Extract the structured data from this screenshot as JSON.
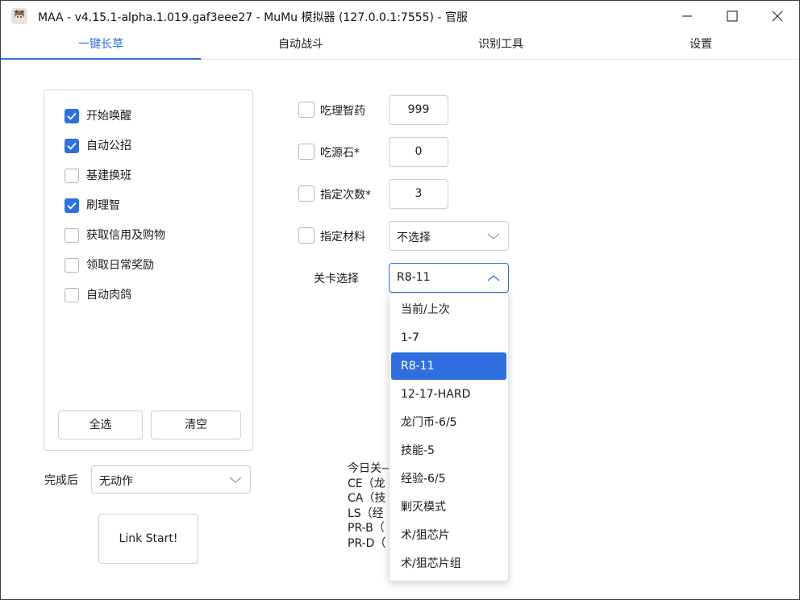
{
  "window": {
    "title": "MAA - v4.15.1-alpha.1.019.gaf3eee27 - MuMu 模拟器 (127.0.0.1:7555) - 官服"
  },
  "tabs": [
    {
      "label": "一键长草",
      "active": true
    },
    {
      "label": "自动战斗",
      "active": false
    },
    {
      "label": "识别工具",
      "active": false
    },
    {
      "label": "设置",
      "active": false
    }
  ],
  "tasks": [
    {
      "label": "开始唤醒",
      "checked": true
    },
    {
      "label": "自动公招",
      "checked": true
    },
    {
      "label": "基建换班",
      "checked": false
    },
    {
      "label": "刷理智",
      "checked": true
    },
    {
      "label": "获取信用及购物",
      "checked": false
    },
    {
      "label": "领取日常奖励",
      "checked": false
    },
    {
      "label": "自动肉鸽",
      "checked": false
    }
  ],
  "task_buttons": {
    "select_all": "全选",
    "clear": "清空"
  },
  "after_complete": {
    "label": "完成后",
    "value": "无动作"
  },
  "start_button": "Link Start!",
  "settings": {
    "medicine": {
      "label": "吃理智药",
      "value": "999",
      "checked": false
    },
    "stone": {
      "label": "吃源石*",
      "value": "0",
      "checked": false
    },
    "times": {
      "label": "指定次数*",
      "value": "3",
      "checked": false
    },
    "material": {
      "label": "指定材料",
      "value": "不选择",
      "checked": false
    },
    "stage": {
      "label": "关卡选择",
      "value": "R8-11"
    }
  },
  "stage_options": [
    {
      "label": "当前/上次",
      "selected": false
    },
    {
      "label": "1-7",
      "selected": false
    },
    {
      "label": "R8-11",
      "selected": true
    },
    {
      "label": "12-17-HARD",
      "selected": false
    },
    {
      "label": "龙门币-6/5",
      "selected": false
    },
    {
      "label": "技能-5",
      "selected": false
    },
    {
      "label": "经验-6/5",
      "selected": false
    },
    {
      "label": "剿灭模式",
      "selected": false
    },
    {
      "label": "术/狙芯片",
      "selected": false
    },
    {
      "label": "术/狙芯片组",
      "selected": false
    }
  ],
  "info_lines": [
    "今日关—",
    "CE（龙",
    "CA（技",
    "LS（经",
    "PR-B（",
    "PR-D（"
  ],
  "colors": {
    "accent": "#2f6fde",
    "border": "#cfcfcf"
  }
}
